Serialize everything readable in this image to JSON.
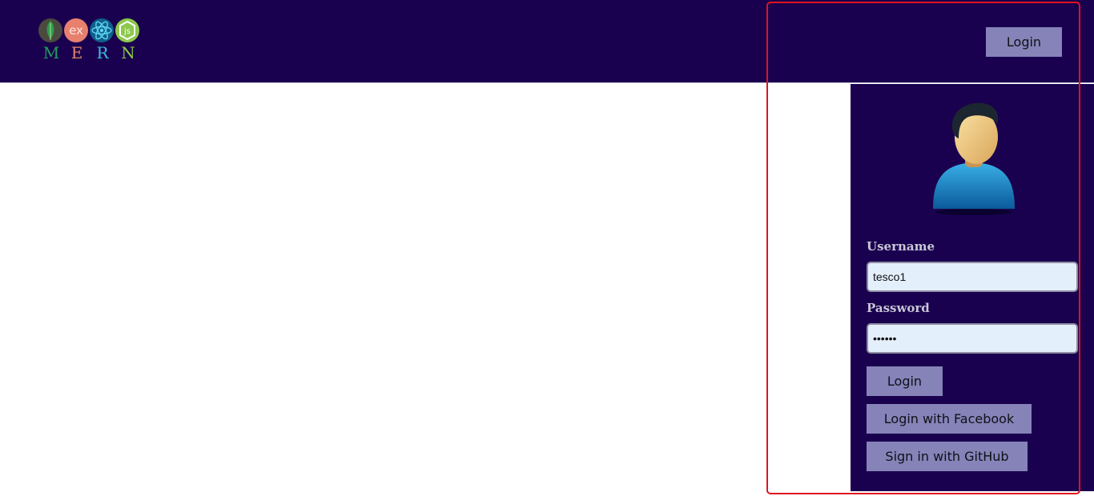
{
  "header": {
    "logo": {
      "letters": [
        "M",
        "E",
        "R",
        "N"
      ],
      "letter_colors": [
        "#1f9e5c",
        "#e8866b",
        "#3cbfe0",
        "#8cc84b"
      ],
      "icons": [
        "mongodb-leaf-icon",
        "express-icon",
        "react-icon",
        "nodejs-icon"
      ],
      "express_text": "ex",
      "node_text": "js"
    },
    "login_label": "Login"
  },
  "login_form": {
    "avatar_icon": "user-avatar-icon",
    "username_label": "Username",
    "username_value": "tesco1",
    "password_label": "Password",
    "password_value": "tesco1",
    "login_label": "Login",
    "facebook_label": "Login with Facebook",
    "github_label": "Sign in with GitHub"
  },
  "colors": {
    "nav_bg": "#1a014f",
    "button_bg": "#8583b8",
    "input_bg": "#e4effc",
    "highlight": "#e0141e"
  }
}
